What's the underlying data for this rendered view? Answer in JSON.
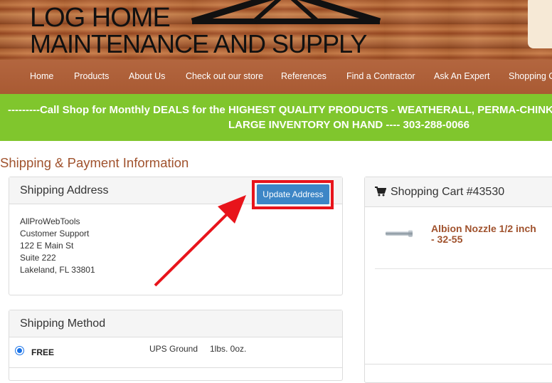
{
  "header": {
    "logo_line1": "LOG HOME",
    "logo_line2": "MAINTENANCE AND SUPPLY"
  },
  "nav": {
    "items": [
      {
        "label": "Home"
      },
      {
        "label": "Products"
      },
      {
        "label": "About Us"
      },
      {
        "label": "Check out our store"
      },
      {
        "label": "References"
      },
      {
        "label": "Find a Contractor"
      },
      {
        "label": "Ask An Expert"
      },
      {
        "label": "Shopping Cart"
      }
    ]
  },
  "promo": {
    "line1": "---------Call Shop for Monthly DEALS for the HIGHEST QUALITY PRODUCTS - WEATHERALL, PERMA-CHINK",
    "line2": "LARGE INVENTORY ON HAND ---- 303-288-0066"
  },
  "page": {
    "title": "Shipping & Payment Information"
  },
  "shipping_address": {
    "title": "Shipping Address",
    "update_button": "Update Address",
    "lines": [
      "AllProWebTools",
      "Customer Support",
      "122 E Main St",
      "Suite 222",
      "Lakeland, FL 33801"
    ]
  },
  "shipping_method": {
    "title": "Shipping Method",
    "selected": true,
    "option_label": "FREE",
    "carrier": "UPS Ground",
    "weight": "1lbs. 0oz."
  },
  "cart": {
    "title": "Shopping Cart #43530",
    "icon": "cart-icon",
    "items": [
      {
        "name": "Albion Nozzle 1/2 inch - 32-55"
      }
    ]
  },
  "colors": {
    "nav_bg": "#a95a33",
    "promo_bg": "#80c62d",
    "accent_brown": "#a0522d",
    "button_blue": "#3d86c6",
    "highlight_red": "#e8141b"
  }
}
